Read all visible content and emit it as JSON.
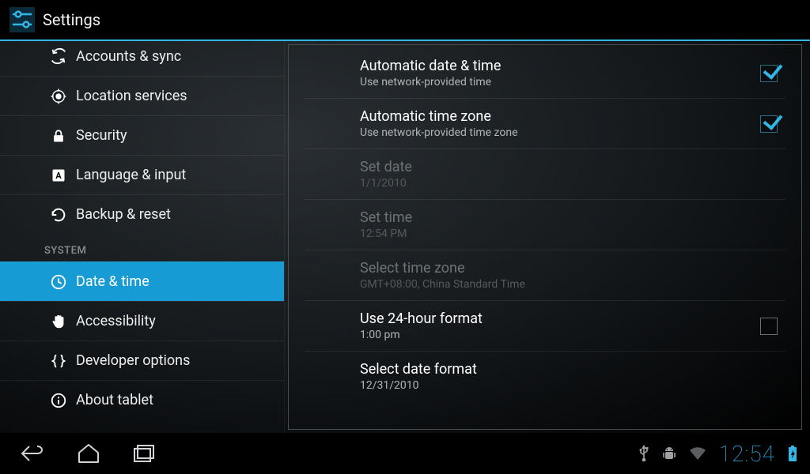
{
  "colors": {
    "accent": "#33b5e5"
  },
  "actionbar": {
    "title": "Settings"
  },
  "sidebar": {
    "items": [
      {
        "icon": "sync",
        "label": "Accounts & sync"
      },
      {
        "icon": "location",
        "label": "Location services"
      },
      {
        "icon": "lock",
        "label": "Security"
      },
      {
        "icon": "language",
        "label": "Language & input"
      },
      {
        "icon": "backup",
        "label": "Backup & reset"
      }
    ],
    "system_header": "SYSTEM",
    "system_items": [
      {
        "icon": "clock",
        "label": "Date & time",
        "selected": true
      },
      {
        "icon": "hand",
        "label": "Accessibility"
      },
      {
        "icon": "braces",
        "label": "Developer options"
      },
      {
        "icon": "info",
        "label": "About tablet"
      }
    ]
  },
  "panel": {
    "rows": [
      {
        "primary": "Automatic date & time",
        "secondary": "Use network-provided time",
        "checkbox": true,
        "checked": true,
        "disabled": false
      },
      {
        "primary": "Automatic time zone",
        "secondary": "Use network-provided time zone",
        "checkbox": true,
        "checked": true,
        "disabled": false
      },
      {
        "primary": "Set date",
        "secondary": "1/1/2010",
        "checkbox": false,
        "disabled": true
      },
      {
        "primary": "Set time",
        "secondary": "12:54 PM",
        "checkbox": false,
        "disabled": true
      },
      {
        "primary": "Select time zone",
        "secondary": "GMT+08:00, China Standard Time",
        "checkbox": false,
        "disabled": true
      },
      {
        "primary": "Use 24-hour format",
        "secondary": "1:00 pm",
        "checkbox": true,
        "checked": false,
        "disabled": false
      },
      {
        "primary": "Select date format",
        "secondary": "12/31/2010",
        "checkbox": false,
        "disabled": false
      }
    ]
  },
  "navbar": {
    "clock": "12:54"
  }
}
